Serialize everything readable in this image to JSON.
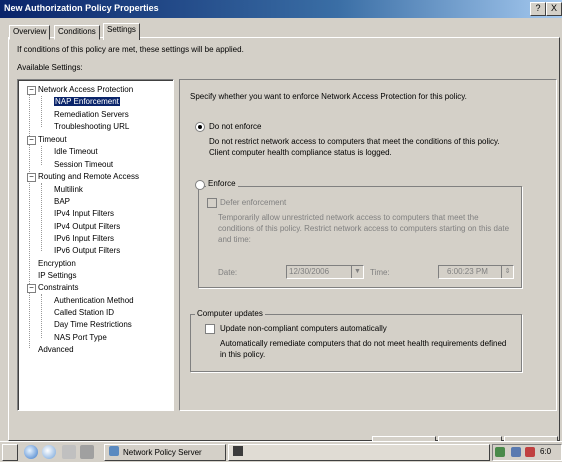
{
  "window": {
    "title": "New Authorization Policy Properties",
    "help_button": "?",
    "close_button": "X"
  },
  "tabs": [
    {
      "label": "Overview",
      "active": false
    },
    {
      "label": "Conditions",
      "active": false
    },
    {
      "label": "Settings",
      "active": true
    }
  ],
  "settings": {
    "intro": "If conditions of this policy are met, these settings will be applied.",
    "available_label": "Available Settings:"
  },
  "tree": {
    "nodes": [
      {
        "label": "Network Access Protection",
        "expanded": true
      },
      {
        "label": "NAP Enforcement",
        "selected": true
      },
      {
        "label": "Remediation Servers"
      },
      {
        "label": "Troubleshooting URL"
      },
      {
        "label": "Timeout",
        "expanded": true
      },
      {
        "label": "Idle Timeout"
      },
      {
        "label": "Session Timeout"
      },
      {
        "label": "Routing and Remote Access",
        "expanded": true
      },
      {
        "label": "Multilink"
      },
      {
        "label": "BAP"
      },
      {
        "label": "IPv4 Input Filters"
      },
      {
        "label": "IPv4 Output Filters"
      },
      {
        "label": "IPv6 Input Filters"
      },
      {
        "label": "IPv6 Output Filters"
      },
      {
        "label": "Encryption"
      },
      {
        "label": "IP Settings"
      },
      {
        "label": "Constraints",
        "expanded": true
      },
      {
        "label": "Authentication Method"
      },
      {
        "label": "Called Station ID"
      },
      {
        "label": "Day Time Restrictions"
      },
      {
        "label": "NAS Port Type"
      },
      {
        "label": "Advanced"
      }
    ],
    "expand_glyph": "−"
  },
  "nap": {
    "header": "Specify whether you want to enforce Network Access Protection for this policy.",
    "do_not_enforce": {
      "label": "Do not enforce",
      "selected": true,
      "description": "Do not restrict network access to computers that meet the conditions of this policy. Client computer health compliance status is logged."
    },
    "enforce": {
      "label": "Enforce",
      "selected": false,
      "defer_label": "Defer enforcement",
      "defer_description": "Temporarily allow unrestricted network access to computers that meet the conditions of this policy. Restrict network access to computers starting on this date and time:",
      "date_label": "Date:",
      "date_value": "12/30/2006",
      "time_label": "Time:",
      "time_value": "6:00:23 PM"
    },
    "updates": {
      "legend": "Computer updates",
      "checkbox_label": "Update non-compliant computers automatically",
      "checked": false,
      "description": "Automatically remediate computers that do not meet health requirements defined in this policy."
    }
  },
  "taskbar": {
    "task_label": "Network Policy Server",
    "clock": "6:0"
  },
  "colors": {
    "titlebar": "#0a246a",
    "face": "#d4d0c8",
    "selection": "#0a246a",
    "desktop": "#6b8fb0"
  }
}
